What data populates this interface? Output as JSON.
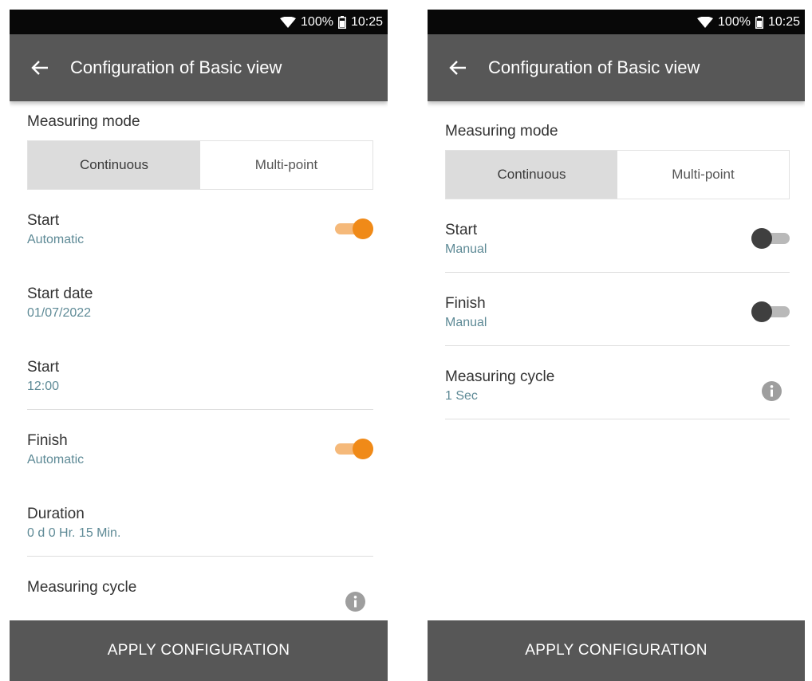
{
  "status_bar": {
    "battery": "100%",
    "time": "10:25"
  },
  "left_screen": {
    "title": "Configuration of Basic view",
    "measuring_mode": {
      "label": "Measuring mode",
      "options": [
        "Continuous",
        "Multi-point"
      ],
      "selected": "Continuous"
    },
    "rows": [
      {
        "title": "Start",
        "value": "Automatic",
        "toggle": "on"
      },
      {
        "title": "Start date",
        "value": "01/07/2022"
      },
      {
        "title": "Start",
        "value": "12:00"
      },
      {
        "title": "Finish",
        "value": "Automatic",
        "toggle": "on"
      },
      {
        "title": "Duration",
        "value": "0 d 0 Hr. 15 Min."
      },
      {
        "title": "Measuring cycle",
        "icon": "info-icon"
      }
    ],
    "apply_label": "APPLY CONFIGURATION"
  },
  "right_screen": {
    "title": "Configuration of Basic view",
    "measuring_mode": {
      "label": "Measuring mode",
      "options": [
        "Continuous",
        "Multi-point"
      ],
      "selected": "Continuous"
    },
    "rows": [
      {
        "title": "Start",
        "value": "Manual",
        "toggle": "off"
      },
      {
        "title": "Finish",
        "value": "Manual",
        "toggle": "off"
      },
      {
        "title": "Measuring cycle",
        "value": "1 Sec",
        "icon": "info-icon"
      }
    ],
    "apply_label": "APPLY CONFIGURATION"
  },
  "colors": {
    "accent": "#f08a18",
    "app_bar": "#575757",
    "value_text": "#5e8a96"
  }
}
